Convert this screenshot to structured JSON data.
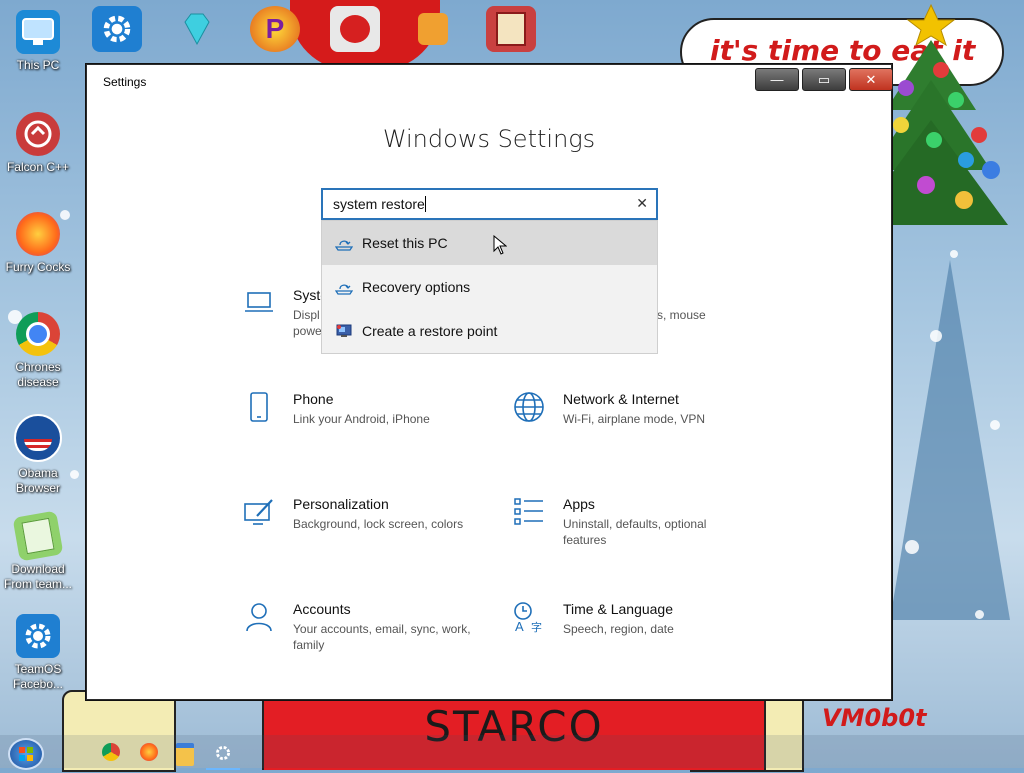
{
  "desktop": {
    "icons": [
      {
        "label": "This PC"
      },
      {
        "label": "Falcon C++"
      },
      {
        "label": "Furry Cocks"
      },
      {
        "label": "Chrones disease"
      },
      {
        "label": "Obama Browser"
      },
      {
        "label": "Download From team..."
      },
      {
        "label": "TeamOS Facebo..."
      }
    ],
    "top_icons": [
      "TeamOS",
      "gem",
      "PEGGING LOL",
      "YouTube",
      "candle",
      "Extras"
    ],
    "wallpaper_text": {
      "bubble": "it's time to eat it",
      "bottom": "STARCO",
      "signature": "VM0b0t"
    }
  },
  "window": {
    "title": "Settings",
    "heading": "Windows Settings",
    "buttons": {
      "minimize": "—",
      "maximize": "▭",
      "close": "✕"
    },
    "search": {
      "value": "system restore",
      "clear_icon": "✕"
    },
    "suggestions": [
      {
        "label": "Reset this PC",
        "icon": "reset-icon",
        "highlighted": true
      },
      {
        "label": "Recovery options",
        "icon": "recovery-icon",
        "highlighted": false
      },
      {
        "label": "Create a restore point",
        "icon": "restore-point-icon",
        "highlighted": false
      }
    ],
    "categories": [
      {
        "name": "Syste",
        "desc": "Displ\npowe",
        "icon": "laptop-icon"
      },
      {
        "name": "",
        "desc": "s, mouse",
        "icon": ""
      },
      {
        "name": "Phone",
        "desc": "Link your Android, iPhone",
        "icon": "phone-icon"
      },
      {
        "name": "Network & Internet",
        "desc": "Wi-Fi, airplane mode, VPN",
        "icon": "globe-icon"
      },
      {
        "name": "Personalization",
        "desc": "Background, lock screen, colors",
        "icon": "personalization-icon"
      },
      {
        "name": "Apps",
        "desc": "Uninstall, defaults, optional features",
        "icon": "apps-icon"
      },
      {
        "name": "Accounts",
        "desc": "Your accounts, email, sync, work, family",
        "icon": "person-icon"
      },
      {
        "name": "Time & Language",
        "desc": "Speech, region, date",
        "icon": "time-language-icon"
      }
    ]
  },
  "taskbar": {
    "items": [
      "start-button",
      "chrome",
      "firefox",
      "file-explorer",
      "settings"
    ]
  },
  "colors": {
    "accent": "#2a74b9",
    "icon_blue": "#1f6fb8"
  }
}
